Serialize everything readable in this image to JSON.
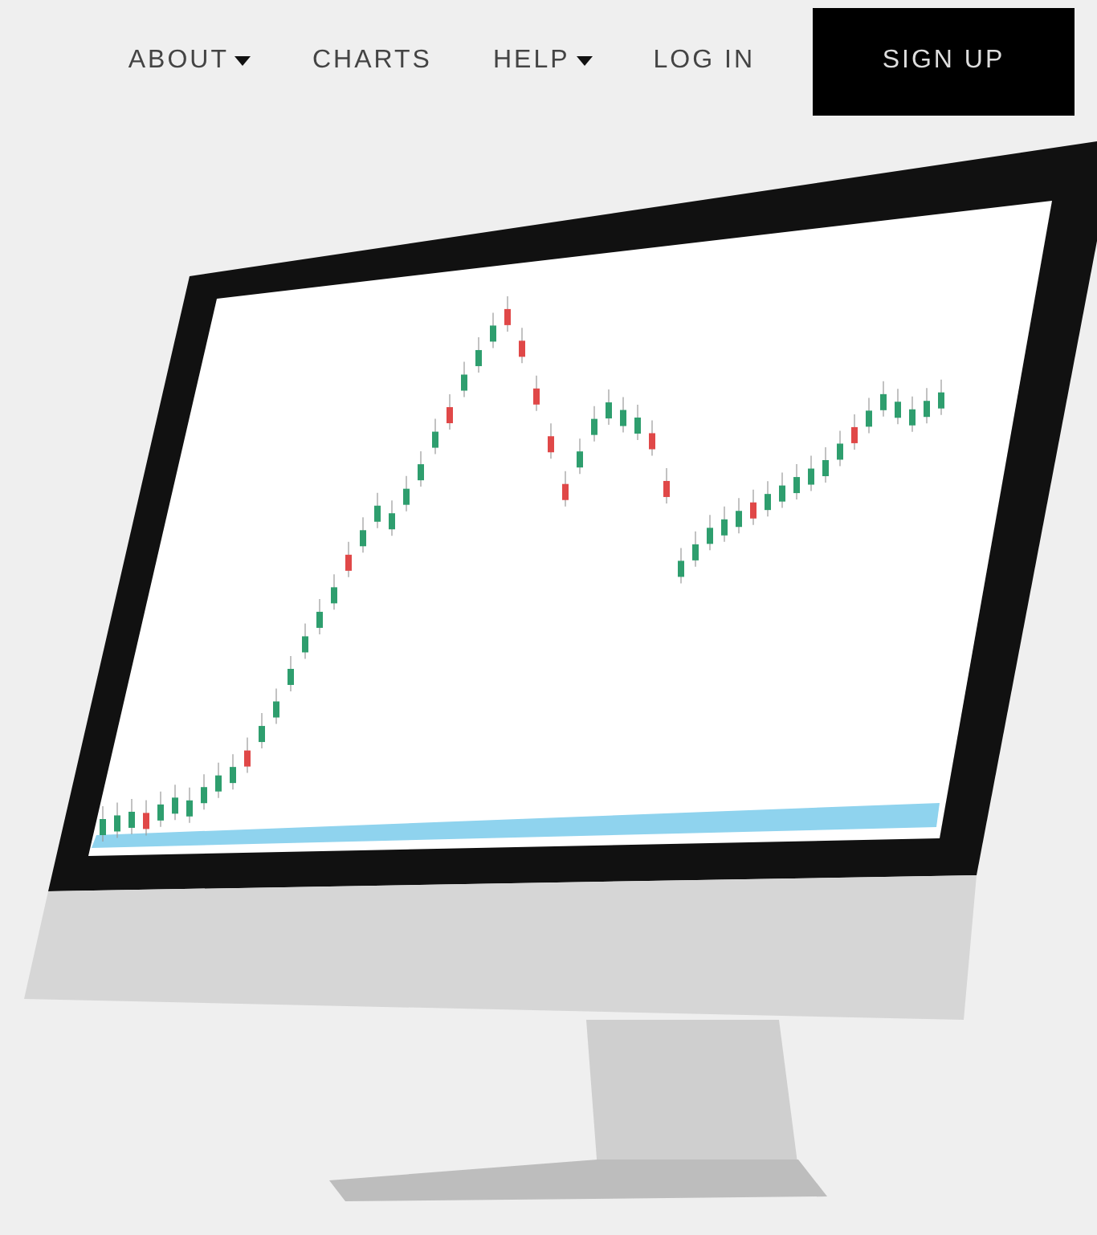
{
  "nav": {
    "items": [
      {
        "label": "ABOUT",
        "dropdown": true
      },
      {
        "label": "CHARTS",
        "dropdown": false
      },
      {
        "label": "HELP",
        "dropdown": true
      },
      {
        "label": "LOG IN",
        "dropdown": false
      }
    ],
    "cta": "SIGN UP"
  }
}
